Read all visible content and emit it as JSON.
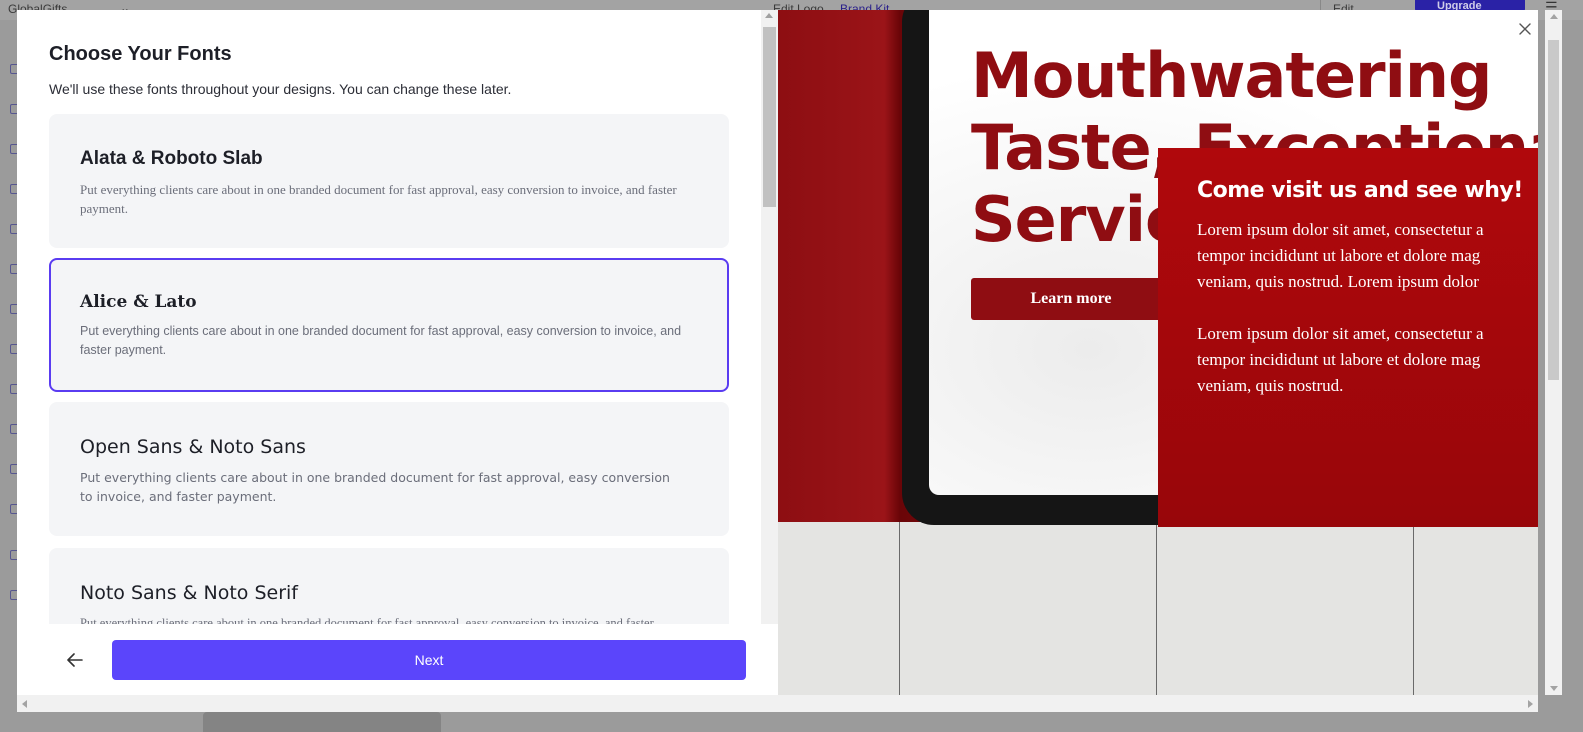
{
  "background_app": {
    "brand_name": "GlobalGifts",
    "nav_links": [
      "Edit Logo",
      "Brand Kit"
    ],
    "edit_brand_label": "Edit Brand",
    "upgrade_label": "Upgrade"
  },
  "modal": {
    "title": "Choose Your Fonts",
    "subtitle": "We'll use these fonts throughout your designs. You can change these later.",
    "font_options": [
      {
        "name": "Alata & Roboto Slab",
        "description": "Put everything clients care about in one branded document for fast approval, easy conversion to invoice, and faster payment.",
        "selected": false
      },
      {
        "name": "Alice & Lato",
        "description": "Put everything clients care about in one branded document for fast approval, easy conversion to invoice, and faster payment.",
        "selected": true
      },
      {
        "name": "Open Sans & Noto Sans",
        "description": "Put everything clients care about in one branded document for fast approval, easy conversion to invoice, and faster payment.",
        "selected": false
      },
      {
        "name": "Noto Sans & Noto Serif",
        "description": "Put everything clients care about in one branded document for fast approval, easy conversion to invoice, and faster payment.",
        "selected": false
      }
    ],
    "next_label": "Next",
    "back_icon": "arrow-left-icon",
    "close_icon": "close-icon"
  },
  "preview": {
    "headline_lines": [
      "Mouthwatering",
      "Taste, Exceptional",
      "Service"
    ],
    "learn_more_label": "Learn more",
    "panel_title": "Come visit us and see why!",
    "panel_paragraph_1": [
      "Lorem ipsum dolor sit amet, consectetur a",
      "tempor incididunt ut labore et dolore mag",
      "veniam, quis nostrud. Lorem ipsum dolor"
    ],
    "panel_paragraph_2": [
      "Lorem ipsum dolor sit amet, consectetur a",
      "tempor incididunt ut labore et dolore mag",
      "veniam, quis nostrud."
    ]
  },
  "colors": {
    "accent": "#5b45fb",
    "selected_border": "#5a3cf1",
    "brand_red": "#8f0d12"
  }
}
